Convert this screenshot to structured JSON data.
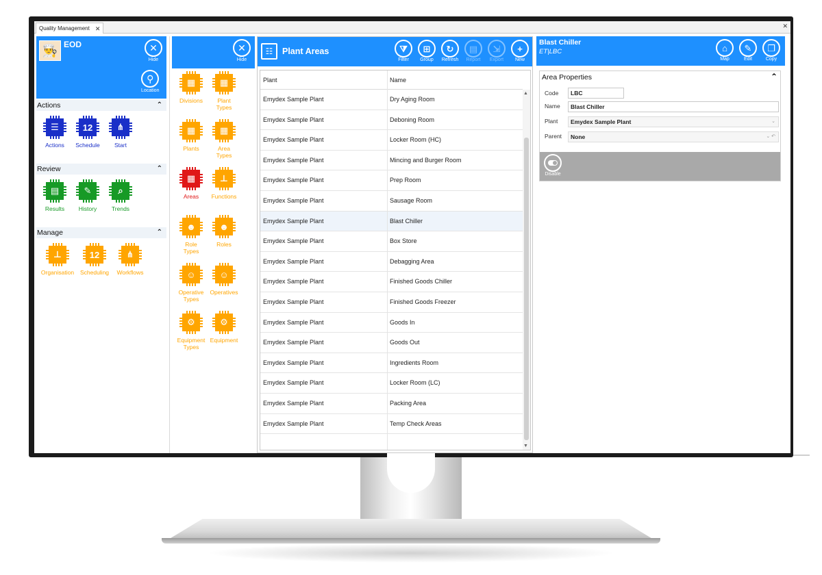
{
  "window": {
    "tab_title": "Quality Management",
    "tab_close": "✕",
    "close": "✕"
  },
  "nav": {
    "user": "EOD",
    "hide_label": "Hide",
    "location_label": "Location",
    "sections": [
      {
        "title": "Actions",
        "items": [
          "Actions",
          "Schedule",
          "Start"
        ]
      },
      {
        "title": "Review",
        "items": [
          "Results",
          "History",
          "Trends"
        ]
      },
      {
        "title": "Manage",
        "items": [
          "Organisation",
          "Scheduling",
          "Workflows"
        ]
      }
    ]
  },
  "admin": {
    "hide_label": "Hide",
    "tiles": [
      [
        "Divisions",
        ""
      ],
      [
        "Plant",
        "Types"
      ],
      [
        "Plants",
        ""
      ],
      [
        "Area",
        "Types"
      ],
      [
        "Areas",
        ""
      ],
      [
        "Functions",
        ""
      ],
      [
        "Role",
        "Types"
      ],
      [
        "Roles",
        ""
      ],
      [
        "Operative",
        "Types"
      ],
      [
        "Operatives",
        ""
      ],
      [
        "Equipment",
        "Types"
      ],
      [
        "Equipment",
        ""
      ]
    ]
  },
  "grid": {
    "title": "Plant Areas",
    "tools": [
      "Filter",
      "Group",
      "Refresh",
      "Report",
      "Export",
      "New"
    ],
    "columns": [
      "Plant",
      "Name"
    ],
    "rows": [
      [
        "Emydex Sample Plant",
        "Dry Aging Room"
      ],
      [
        "Emydex Sample Plant",
        "Deboning Room"
      ],
      [
        "Emydex Sample Plant",
        "Locker Room (HC)"
      ],
      [
        "Emydex Sample Plant",
        "Mincing and Burger Room"
      ],
      [
        "Emydex Sample Plant",
        "Prep Room"
      ],
      [
        "Emydex Sample Plant",
        "Sausage Room"
      ],
      [
        "Emydex Sample Plant",
        "Blast Chiller"
      ],
      [
        "Emydex Sample Plant",
        "Box Store"
      ],
      [
        "Emydex Sample Plant",
        "Debagging Area"
      ],
      [
        "Emydex Sample Plant",
        "Finished Goods Chiller"
      ],
      [
        "Emydex Sample Plant",
        "Finished Goods Freezer"
      ],
      [
        "Emydex Sample Plant",
        "Goods In"
      ],
      [
        "Emydex Sample Plant",
        "Goods Out"
      ],
      [
        "Emydex Sample Plant",
        "Ingredients Room"
      ],
      [
        "Emydex Sample Plant",
        "Locker Room (LC)"
      ],
      [
        "Emydex Sample Plant",
        "Packing Area"
      ],
      [
        "Emydex Sample Plant",
        "Temp Check Areas"
      ]
    ],
    "selected_index": 6
  },
  "detail": {
    "title": "Blast Chiller",
    "subtitle": "ET|LBC",
    "tools": [
      "Map",
      "Edit",
      "Copy"
    ],
    "props_title": "Area Properties",
    "fields": {
      "code_label": "Code",
      "code_value": "LBC",
      "name_label": "Name",
      "name_value": "Blast Chiller",
      "plant_label": "Plant",
      "plant_value": "Emydex Sample Plant",
      "parent_label": "Parent",
      "parent_value": "None"
    },
    "disable_label": "Disable"
  },
  "colors": {
    "accent": "#1e90ff",
    "actions": "#1a2fc8",
    "review": "#179a26",
    "manage": "#ffa500",
    "active_area": "#e01818"
  },
  "icons": {
    "hide": "close-icon",
    "location": "location-user-icon",
    "filter": "filter-icon",
    "group": "group-icon",
    "refresh": "refresh-icon",
    "report": "report-icon",
    "export": "export-icon",
    "new": "plus-icon",
    "map": "map-icon",
    "edit": "pencil-icon",
    "copy": "copy-icon",
    "disable": "toggle-icon"
  }
}
